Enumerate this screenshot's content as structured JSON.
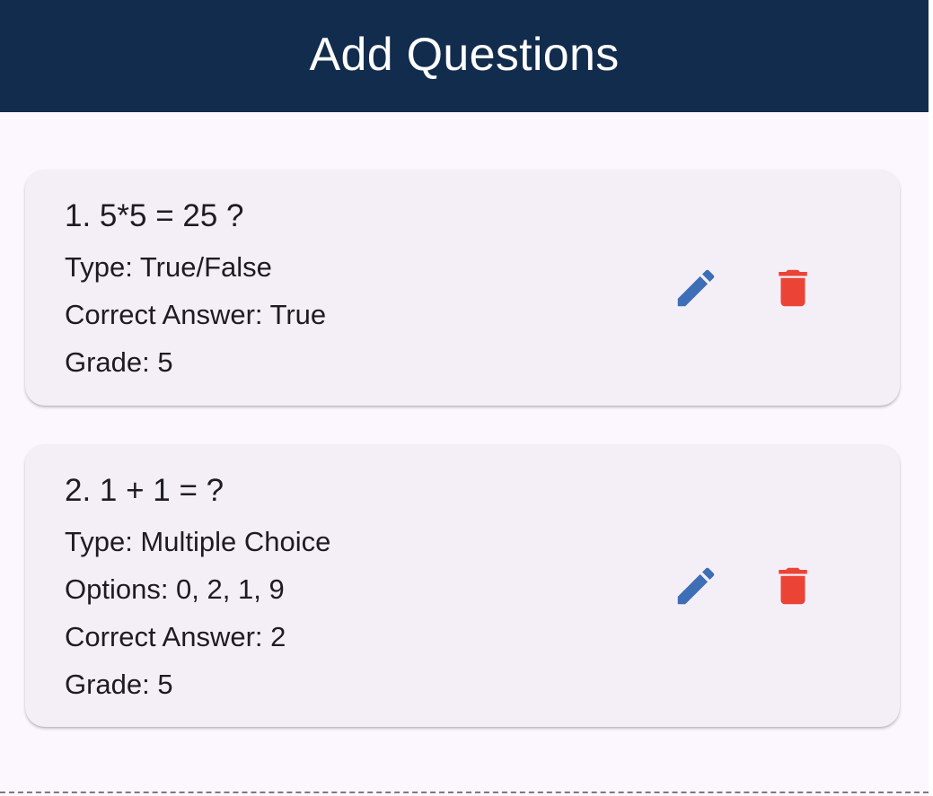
{
  "app_bar": {
    "title": "Add Questions",
    "background_color": "#122c4d"
  },
  "questions": [
    {
      "title": "1. 5*5 = 25 ?",
      "lines": [
        "Type: True/False",
        "Correct Answer: True",
        "Grade: 5"
      ],
      "actions": {
        "edit_icon": "pencil-icon",
        "delete_icon": "trash-icon"
      }
    },
    {
      "title": "2. 1 + 1 = ?",
      "lines": [
        "Type: Multiple Choice",
        "Options: 0, 2, 1, 9",
        "Correct Answer: 2",
        "Grade: 5"
      ],
      "actions": {
        "edit_icon": "pencil-icon",
        "delete_icon": "trash-icon"
      }
    }
  ],
  "colors": {
    "edit_icon": "#3e6fb6",
    "delete_icon": "#eb4335",
    "card_background": "#f4eff7",
    "screen_background": "#fcf7fe"
  }
}
